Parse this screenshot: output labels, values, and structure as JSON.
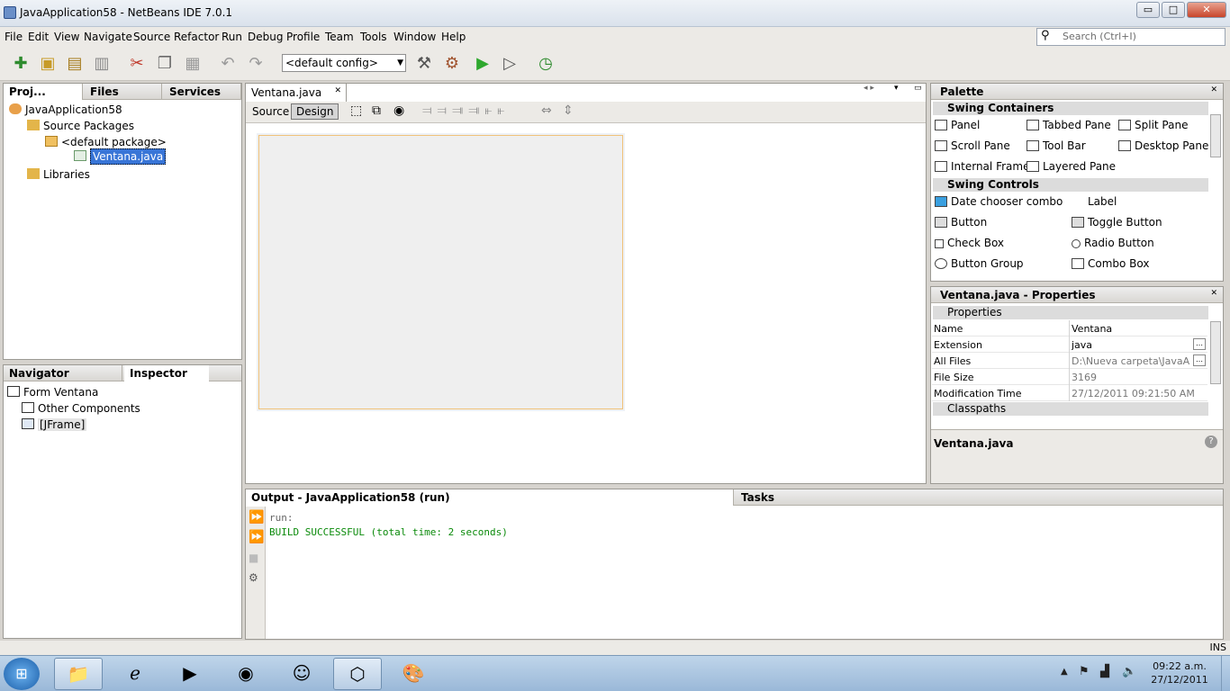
{
  "window": {
    "title": "JavaApplication58 - NetBeans IDE 7.0.1",
    "min": "▭",
    "max": "□",
    "close": "✕"
  },
  "menu": [
    "File",
    "Edit",
    "View",
    "Navigate",
    "Source",
    "Refactor",
    "Run",
    "Debug",
    "Profile",
    "Team",
    "Tools",
    "Window",
    "Help"
  ],
  "search": {
    "placeholder": "Search (Ctrl+I)"
  },
  "toolbar": {
    "config": "<default config>"
  },
  "projects": {
    "tabs": [
      "Proj...",
      "Files",
      "Services"
    ],
    "tree": {
      "root": "JavaApplication58",
      "src": "Source Packages",
      "pkg": "<default package>",
      "file": "Ventana.java",
      "libs": "Libraries"
    }
  },
  "navigator": {
    "tabs": [
      "Navigator",
      "Inspector"
    ],
    "tree": {
      "form": "Form Ventana",
      "other": "Other Components",
      "frame": "[JFrame]"
    }
  },
  "editor": {
    "tab": "Ventana.java",
    "source": "Source",
    "design": "Design"
  },
  "palette": {
    "title": "Palette",
    "containers_header": "Swing Containers",
    "containers": [
      "Panel",
      "Tabbed Pane",
      "Split Pane",
      "Scroll Pane",
      "Tool Bar",
      "Desktop Pane",
      "Internal Frame",
      "Layered Pane"
    ],
    "controls_header": "Swing Controls",
    "controls": [
      "Date chooser combo",
      "Label",
      "Button",
      "Toggle Button",
      "Check Box",
      "Radio Button",
      "Button Group",
      "Combo Box"
    ]
  },
  "properties": {
    "title": "Ventana.java - Properties",
    "section1": "Properties",
    "rows": [
      {
        "k": "Name",
        "v": "Ventana"
      },
      {
        "k": "Extension",
        "v": "java"
      },
      {
        "k": "All Files",
        "v": "D:\\Nueva carpeta\\JavaAp..."
      },
      {
        "k": "File Size",
        "v": "3169"
      },
      {
        "k": "Modification Time",
        "v": "27/12/2011 09:21:50 AM"
      }
    ],
    "section2": "Classpaths",
    "footer": "Ventana.java"
  },
  "output": {
    "title": "Output - JavaApplication58 (run)",
    "tasks": "Tasks",
    "line1": "run:",
    "line2": "BUILD SUCCESSFUL (total time: 2 seconds)"
  },
  "status": {
    "ins": "INS"
  },
  "clock": {
    "time": "09:22 a.m.",
    "date": "27/12/2011"
  }
}
